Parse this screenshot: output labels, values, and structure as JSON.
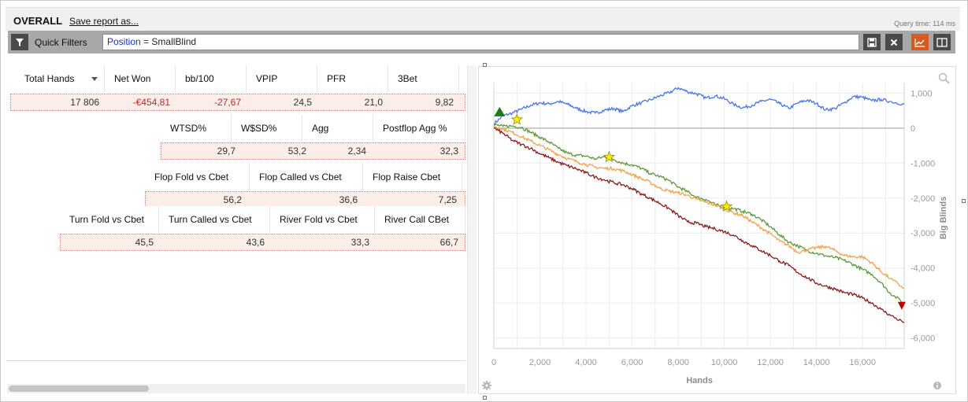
{
  "header": {
    "title": "OVERALL",
    "save_link": "Save report as...",
    "query_time": "Query time: 114 ms"
  },
  "filters": {
    "label": "Quick Filters",
    "filter_key": "Position",
    "filter_op": " = ",
    "filter_value": "SmallBlind"
  },
  "stats": {
    "row1": {
      "headers": [
        "Total Hands",
        "Net Won",
        "bb/100",
        "VPIP",
        "PFR",
        "3Bet"
      ],
      "values": [
        "17 806",
        "-€454,81",
        "-27,67",
        "24,5",
        "21,0",
        "9,82"
      ]
    },
    "row2": {
      "headers": [
        "WTSD%",
        "W$SD%",
        "Agg",
        "Postflop Agg %"
      ],
      "values": [
        "29,7",
        "53,2",
        "2,34",
        "32,3"
      ]
    },
    "row3": {
      "headers": [
        "Flop Fold vs Cbet",
        "Flop Called vs Cbet",
        "Flop Raise Cbet"
      ],
      "values": [
        "56,2",
        "36,6",
        "7,25"
      ]
    },
    "row4": {
      "headers": [
        "Turn Fold vs Cbet",
        "Turn Called vs Cbet",
        "River Fold vs Cbet",
        "River Call CBet"
      ],
      "values": [
        "45,5",
        "43,6",
        "33,3",
        "66,7"
      ]
    }
  },
  "colors": {
    "accent": "#d85a1e",
    "negative": "#d42020",
    "blue_series": "#4a74e8",
    "green_series": "#5d9a3a",
    "orange_series": "#f2a24a",
    "darkred_series": "#8e1a1a"
  },
  "chart_data": {
    "type": "line",
    "xlabel": "Hands",
    "ylabel": "Big Blinds",
    "xlim": [
      0,
      17806
    ],
    "ylim": [
      -6300,
      1300
    ],
    "x_ticks": [
      0,
      2000,
      4000,
      6000,
      8000,
      10000,
      12000,
      14000,
      16000
    ],
    "x_tick_labels": [
      "0",
      "2,000",
      "4,000",
      "6,000",
      "8,000",
      "10,000",
      "12,000",
      "14,000",
      "16,000"
    ],
    "y_ticks": [
      1000,
      0,
      -1000,
      -2000,
      -3000,
      -4000,
      -5000,
      -6000
    ],
    "y_tick_labels": [
      "1,000",
      "0",
      "-1,000",
      "-2,000",
      "-3,000",
      "-4,000",
      "-5,000",
      "-6,000"
    ],
    "grid": true,
    "series": [
      {
        "color": "#4a74e8",
        "x": [
          0,
          400,
          800,
          1200,
          1600,
          2000,
          2400,
          2800,
          3200,
          3600,
          4000,
          4400,
          4800,
          5200,
          5600,
          6000,
          6400,
          6800,
          7200,
          7600,
          8000,
          8400,
          8800,
          9200,
          9600,
          10000,
          10400,
          10800,
          11200,
          11600,
          12000,
          12400,
          12800,
          13200,
          13600,
          14000,
          14400,
          14800,
          15200,
          15600,
          16000,
          16400,
          16800,
          17200,
          17806
        ],
        "y": [
          120,
          350,
          430,
          540,
          650,
          720,
          690,
          760,
          680,
          560,
          470,
          430,
          510,
          560,
          470,
          640,
          720,
          810,
          920,
          1010,
          1150,
          1040,
          980,
          860,
          920,
          840,
          680,
          580,
          650,
          760,
          820,
          700,
          560,
          720,
          800,
          700,
          520,
          560,
          720,
          900,
          880,
          780,
          820,
          760,
          680
        ]
      },
      {
        "color": "#5d9a3a",
        "x": [
          0,
          400,
          800,
          1200,
          1600,
          2000,
          2400,
          2800,
          3200,
          3600,
          4000,
          4400,
          4800,
          5200,
          5600,
          6000,
          6400,
          6800,
          7200,
          7600,
          8000,
          8400,
          8800,
          9200,
          9600,
          10000,
          10400,
          10800,
          11200,
          11600,
          12000,
          12400,
          12800,
          13200,
          13600,
          14000,
          14400,
          14800,
          15200,
          15600,
          16000,
          16400,
          16800,
          17200,
          17806
        ],
        "y": [
          100,
          50,
          60,
          20,
          -120,
          -260,
          -400,
          -580,
          -720,
          -780,
          -800,
          -880,
          -820,
          -900,
          -1000,
          -1050,
          -1150,
          -1300,
          -1380,
          -1500,
          -1680,
          -1820,
          -1980,
          -2040,
          -2190,
          -2260,
          -2300,
          -2380,
          -2460,
          -2620,
          -2820,
          -3050,
          -3260,
          -3370,
          -3500,
          -3580,
          -3650,
          -3700,
          -3780,
          -3900,
          -4040,
          -4180,
          -4420,
          -4720,
          -5000
        ]
      },
      {
        "color": "#f2a24a",
        "x": [
          0,
          400,
          800,
          1200,
          1600,
          2000,
          2400,
          2800,
          3200,
          3600,
          4000,
          4400,
          4800,
          5200,
          5600,
          6000,
          6400,
          6800,
          7200,
          7600,
          8000,
          8400,
          8800,
          9200,
          9600,
          10000,
          10400,
          10800,
          11200,
          11600,
          12000,
          12400,
          12800,
          13200,
          13600,
          14000,
          14400,
          14800,
          15200,
          15600,
          16000,
          16400,
          16800,
          17200,
          17806
        ],
        "y": [
          50,
          -30,
          -120,
          -250,
          -370,
          -500,
          -620,
          -760,
          -870,
          -960,
          -1040,
          -1120,
          -1150,
          -1160,
          -1220,
          -1330,
          -1440,
          -1560,
          -1720,
          -1800,
          -1850,
          -1920,
          -2040,
          -2120,
          -2200,
          -2310,
          -2420,
          -2500,
          -2680,
          -2850,
          -3020,
          -3230,
          -3360,
          -3550,
          -3480,
          -3420,
          -3380,
          -3500,
          -3640,
          -3680,
          -3680,
          -3850,
          -4100,
          -4300,
          -4580
        ]
      },
      {
        "color": "#8e1a1a",
        "x": [
          0,
          400,
          800,
          1200,
          1600,
          2000,
          2400,
          2800,
          3200,
          3600,
          4000,
          4400,
          4800,
          5200,
          5600,
          6000,
          6400,
          6800,
          7200,
          7600,
          8000,
          8400,
          8800,
          9200,
          9600,
          10000,
          10400,
          10800,
          11200,
          11600,
          12000,
          12400,
          12800,
          13200,
          13600,
          14000,
          14400,
          14800,
          15200,
          15600,
          16000,
          16400,
          16800,
          17200,
          17806
        ],
        "y": [
          0,
          -150,
          -350,
          -470,
          -580,
          -730,
          -850,
          -980,
          -1080,
          -1170,
          -1280,
          -1400,
          -1480,
          -1560,
          -1620,
          -1730,
          -1880,
          -2010,
          -2150,
          -2300,
          -2500,
          -2680,
          -2720,
          -2820,
          -2880,
          -2960,
          -3060,
          -3220,
          -3360,
          -3500,
          -3640,
          -3800,
          -3930,
          -4130,
          -4280,
          -4430,
          -4520,
          -4600,
          -4700,
          -4760,
          -4860,
          -5000,
          -5180,
          -5350,
          -5560
        ]
      }
    ],
    "markers": [
      {
        "kind": "triangle-up",
        "color": "#1b7a1b",
        "x": 250,
        "y": 470
      },
      {
        "kind": "star",
        "color": "#ffea00",
        "x": 1000,
        "y": 240
      },
      {
        "kind": "star",
        "color": "#ffea00",
        "x": 5000,
        "y": -830
      },
      {
        "kind": "star",
        "color": "#ffea00",
        "x": 10100,
        "y": -2240
      },
      {
        "kind": "triangle-down",
        "color": "#c00000",
        "x": 17700,
        "y": -5080
      }
    ]
  }
}
